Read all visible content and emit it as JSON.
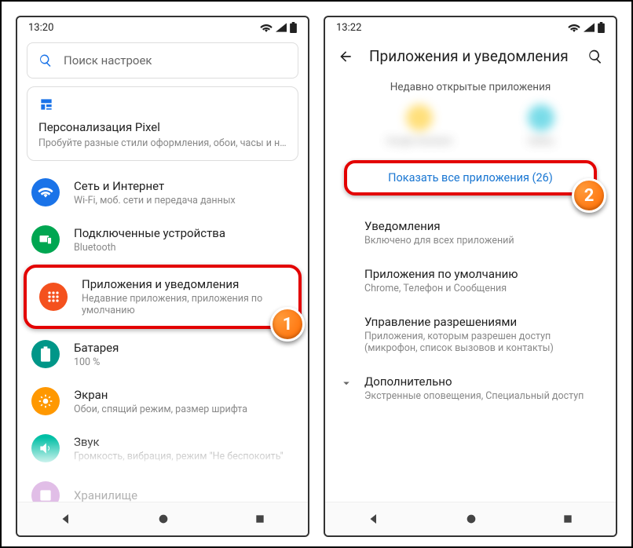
{
  "step_badges": {
    "one": "1",
    "two": "2"
  },
  "screen1": {
    "time": "13:20",
    "search_placeholder": "Поиск настроек",
    "promo": {
      "title": "Персонализация Pixel",
      "subtitle": "Пробуйте разные стили оформления, обои, часы и не…"
    },
    "items": [
      {
        "icon_bg": "#1a73e8",
        "title": "Сеть и Интернет",
        "sub": "Wi-Fi, моб. сети и передача данных"
      },
      {
        "icon_bg": "#00a651",
        "title": "Подключенные устройства",
        "sub": "Bluetooth"
      },
      {
        "icon_bg": "#f4511e",
        "title": "Приложения и уведомления",
        "sub": "Недавние приложения, приложения по умолчанию",
        "highlight": true
      },
      {
        "icon_bg": "#009688",
        "title": "Батарея",
        "sub": "100 %"
      },
      {
        "icon_bg": "#ff9800",
        "title": "Экран",
        "sub": "Обои, спящий режим, размер шрифта"
      },
      {
        "icon_bg": "#00bfa5",
        "title": "Звук",
        "sub": "Громкость, вибрация, режим \"Не беспокоить\""
      },
      {
        "icon_bg": "#9e9e9e",
        "title": "Хранилище",
        "sub": "",
        "faded": true
      }
    ]
  },
  "screen2": {
    "time": "13:22",
    "header": "Приложения и уведомления",
    "section_recent": "Недавно открытые приложения",
    "recent": [
      {
        "name": "Google Assistant",
        "color": "a"
      },
      {
        "name": "Gallery",
        "color": "b"
      }
    ],
    "show_all": "Показать все приложения (26)",
    "rows": [
      {
        "title": "Уведомления",
        "sub": "Включено для всех приложений"
      },
      {
        "title": "Приложения по умолчанию",
        "sub": "Chrome, Телефон и Сообщения"
      },
      {
        "title": "Управление разрешениями",
        "sub": "Приложения, которым разрешен доступ (микрофон, список вызовов и контакты)"
      },
      {
        "title": "Дополнительно",
        "sub": "Экстренные оповещения, Специальный доступ",
        "expand": true
      }
    ]
  }
}
